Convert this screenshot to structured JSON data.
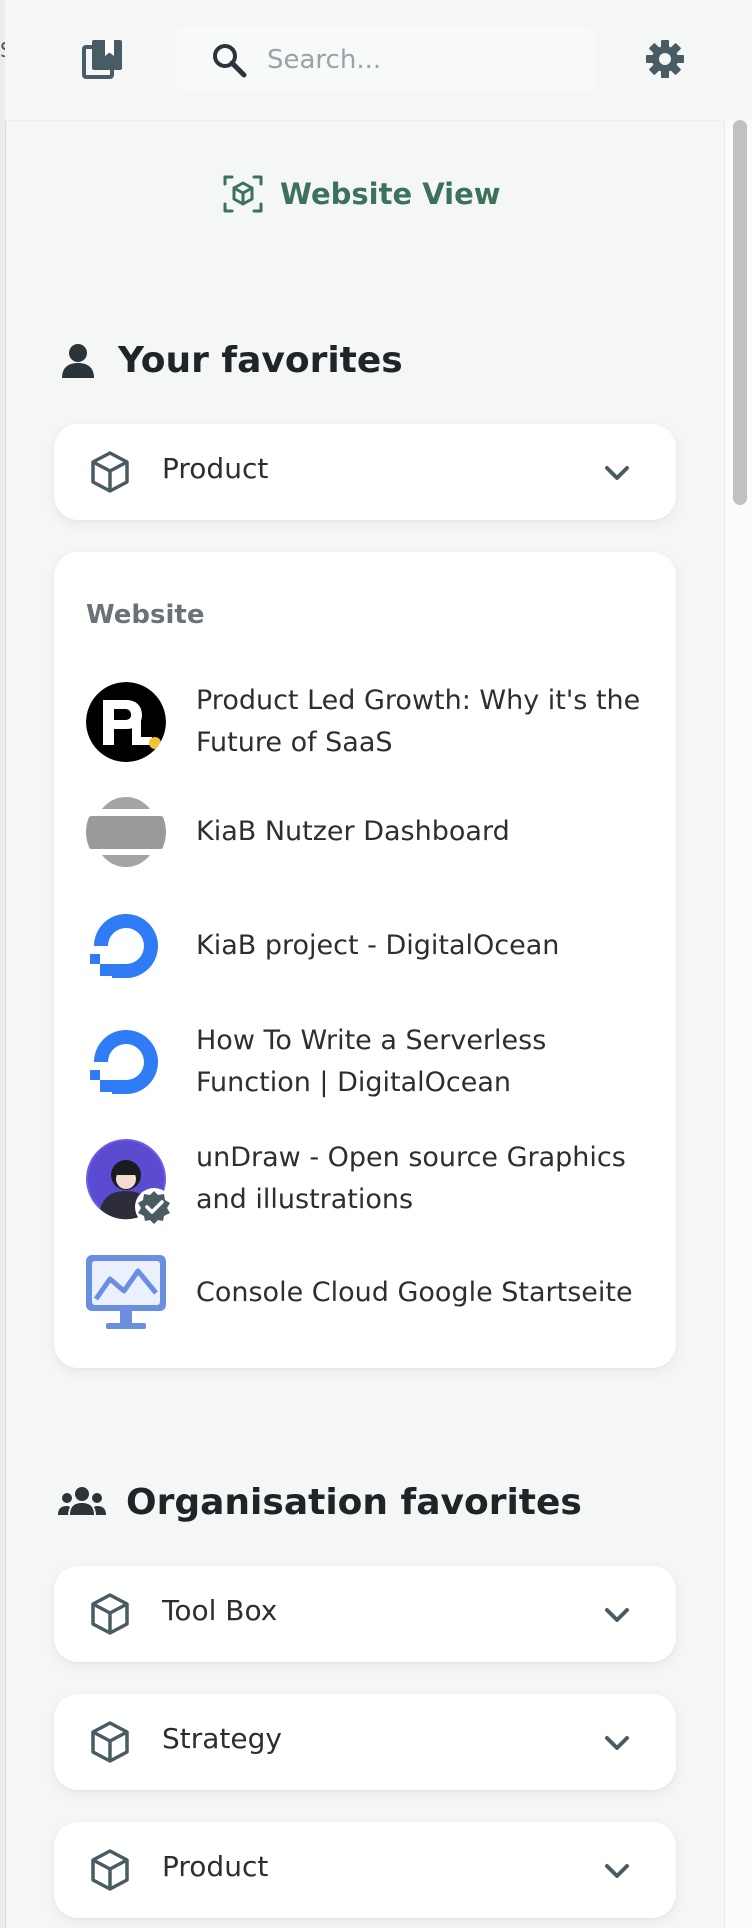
{
  "edge_glyph": "S",
  "search": {
    "placeholder": "Search...",
    "value": ""
  },
  "website_view": {
    "label": "Website View"
  },
  "your_favorites": {
    "title": "Your favorites",
    "groups": [
      {
        "label": "Product"
      }
    ]
  },
  "website_list": {
    "heading": "Website",
    "items": [
      {
        "title": "Product Led Growth: Why it's the Future of SaaS",
        "icon": "product-led-logo"
      },
      {
        "title": "KiaB Nutzer Dashboard",
        "icon": "kiab-logo"
      },
      {
        "title": "KiaB project - DigitalOcean",
        "icon": "digitalocean-logo"
      },
      {
        "title": "How To Write a Serverless Function | DigitalOcean",
        "icon": "digitalocean-logo"
      },
      {
        "title": "unDraw - Open source Graphics and illustrations",
        "icon": "undraw-avatar"
      },
      {
        "title": "Console Cloud Google Startseite",
        "icon": "monitor-chart-logo"
      }
    ]
  },
  "organisation_favorites": {
    "title": "Organisation favorites",
    "groups": [
      {
        "label": "Tool Box"
      },
      {
        "label": "Strategy"
      },
      {
        "label": "Product"
      }
    ]
  },
  "colors": {
    "accent_green": "#3c725b",
    "background": "#f5f7f6",
    "digitalocean_blue": "#2f7cf6",
    "icon_slate": "#4a5c63"
  }
}
